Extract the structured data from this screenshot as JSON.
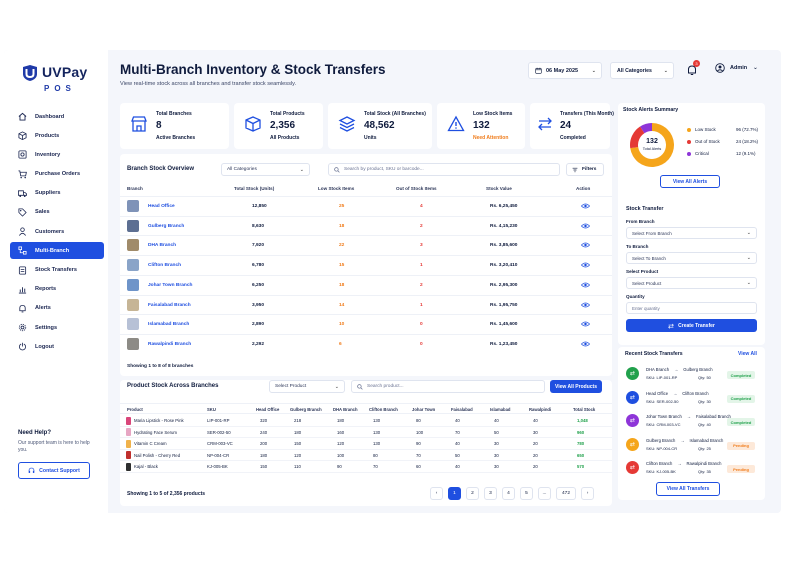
{
  "app": {
    "name": "UVPay",
    "sub": "POS"
  },
  "sidebar": {
    "items": [
      {
        "label": "Dashboard",
        "icon": "home-icon"
      },
      {
        "label": "Products",
        "icon": "box-icon"
      },
      {
        "label": "Inventory",
        "icon": "inventory-icon"
      },
      {
        "label": "Purchase Orders",
        "icon": "cart-icon"
      },
      {
        "label": "Suppliers",
        "icon": "truck-icon"
      },
      {
        "label": "Sales",
        "icon": "tag-icon"
      },
      {
        "label": "Customers",
        "icon": "users-icon"
      },
      {
        "label": "Multi-Branch",
        "icon": "branch-icon"
      },
      {
        "label": "Stock Transfers",
        "icon": "transfer-icon"
      },
      {
        "label": "Reports",
        "icon": "report-icon"
      },
      {
        "label": "Alerts",
        "icon": "alert-icon"
      },
      {
        "label": "Settings",
        "icon": "gear-icon"
      },
      {
        "label": "Logout",
        "icon": "logout-icon"
      }
    ],
    "active_index": 7,
    "help": {
      "title": "Need Help?",
      "text": "Our support team is here to help you.",
      "button": "Contact Support"
    }
  },
  "header": {
    "title": "Multi-Branch Inventory & Stock Transfers",
    "subtitle": "View real-time stock across all branches and transfer stock seamlessly.",
    "date": "06 May 2025",
    "category": "All Categories",
    "notifications": "3",
    "user": "Admin"
  },
  "stats": [
    {
      "label": "Total Branches",
      "value": "8",
      "sub": "Active Branches",
      "icon": "store-icon"
    },
    {
      "label": "Total Products",
      "value": "2,356",
      "sub": "All Products",
      "icon": "cube-icon"
    },
    {
      "label": "Total Stock (All Branches)",
      "value": "48,562",
      "sub": "Units",
      "icon": "layers-icon"
    },
    {
      "label": "Low Stock Items",
      "value": "132",
      "sub": "Need Attention",
      "icon": "warning-icon"
    },
    {
      "label": "Transfers (This Month)",
      "value": "24",
      "sub": "Completed",
      "icon": "swap-icon"
    }
  ],
  "branch_overview": {
    "title": "Branch Stock Overview",
    "category": "All Categories",
    "search_placeholder": "Search by product, SKU or barcode...",
    "filters": "Filters",
    "columns": [
      "Branch",
      "Total Stock (Units)",
      "Low Stock Items",
      "Out of Stock Items",
      "Stock Value",
      "Action"
    ],
    "rows": [
      {
        "name": "Head Office",
        "total": "12,850",
        "low": "25",
        "out": "4",
        "value": "Rs. 6,25,450"
      },
      {
        "name": "Gulberg Branch",
        "total": "8,630",
        "low": "18",
        "out": "2",
        "value": "Rs. 4,15,230"
      },
      {
        "name": "DHA Branch",
        "total": "7,920",
        "low": "22",
        "out": "3",
        "value": "Rs. 3,85,600"
      },
      {
        "name": "Clifton Branch",
        "total": "6,780",
        "low": "15",
        "out": "1",
        "value": "Rs. 3,20,410"
      },
      {
        "name": "Johar Town Branch",
        "total": "6,250",
        "low": "18",
        "out": "2",
        "value": "Rs. 2,95,300"
      },
      {
        "name": "Faisalabad Branch",
        "total": "3,950",
        "low": "14",
        "out": "1",
        "value": "Rs. 1,95,750"
      },
      {
        "name": "Islamabad Branch",
        "total": "2,890",
        "low": "10",
        "out": "0",
        "value": "Rs. 1,45,600"
      },
      {
        "name": "Rawalpindi Branch",
        "total": "2,292",
        "low": "6",
        "out": "0",
        "value": "Rs. 1,23,450"
      }
    ],
    "footer": "Showing 1 to 8 of 8 branches"
  },
  "product_stock": {
    "title": "Product Stock Across Branches",
    "select_product": "Select Product",
    "search_placeholder": "Search product...",
    "view_all": "View All Products",
    "columns": [
      "Product",
      "SKU",
      "Head Office",
      "Gulberg Branch",
      "DHA Branch",
      "Clifton Branch",
      "Johar Town",
      "Faisalabad",
      "Islamabad",
      "Rawalpindi",
      "Total Stock"
    ],
    "rows": [
      {
        "name": "Maria Lipstick - Rose Pink",
        "sku": "LIP-001-RP",
        "vals": [
          "320",
          "218",
          "180",
          "130",
          "80",
          "40",
          "40",
          "40"
        ],
        "total": "1,048"
      },
      {
        "name": "Hydrating Face Serum",
        "sku": "SER-002-50",
        "vals": [
          "240",
          "180",
          "160",
          "130",
          "100",
          "70",
          "50",
          "30"
        ],
        "total": "960"
      },
      {
        "name": "Vitamin C Cream",
        "sku": "CRM-003-VC",
        "vals": [
          "200",
          "150",
          "120",
          "130",
          "90",
          "40",
          "30",
          "20"
        ],
        "total": "780"
      },
      {
        "name": "Nail Polish - Cherry Red",
        "sku": "NP-004-CR",
        "vals": [
          "180",
          "120",
          "100",
          "80",
          "70",
          "50",
          "30",
          "20"
        ],
        "total": "650"
      },
      {
        "name": "Kajal - Black",
        "sku": "KJ-005-BK",
        "vals": [
          "150",
          "110",
          "90",
          "70",
          "60",
          "40",
          "30",
          "20"
        ],
        "total": "570"
      }
    ],
    "footer": "Showing 1 to 5 of 2,356 products",
    "pages": [
      "‹",
      "1",
      "2",
      "3",
      "4",
      "5",
      "...",
      "472",
      "›"
    ]
  },
  "stock_alerts": {
    "title": "Stock Alerts Summary",
    "center_value": "132",
    "center_label": "Total Alerts",
    "items": [
      {
        "label": "Low Stock",
        "value": "96 (72.7%)",
        "color": "#f5a51b",
        "fraction": 0.727
      },
      {
        "label": "Out of Stock",
        "value": "24 (18.2%)",
        "color": "#e53935",
        "fraction": 0.182
      },
      {
        "label": "Critical",
        "value": "12 (9.1%)",
        "color": "#8e35d8",
        "fraction": 0.091
      }
    ],
    "view_all": "View All Alerts"
  },
  "stock_transfer": {
    "title": "Stock Transfer",
    "from_label": "From Branch",
    "from_placeholder": "Select From Branch",
    "to_label": "To Branch",
    "to_placeholder": "Select To Branch",
    "product_label": "Select Product",
    "product_placeholder": "Select Product",
    "qty_label": "Quantity",
    "qty_placeholder": "Enter quantity",
    "submit": "Create Transfer"
  },
  "recent_transfers": {
    "title": "Recent Stock Transfers",
    "view_all": "View All",
    "items": [
      {
        "from": "DHA Branch",
        "to": "Gulberg Branch",
        "sku": "SKU: LIP-001-RP",
        "qty": "Qty: 50",
        "status": "Completed",
        "color": "#21a14c"
      },
      {
        "from": "Head Office",
        "to": "Clifton Branch",
        "sku": "SKU: SER-002-50",
        "qty": "Qty: 30",
        "status": "Completed",
        "color": "#1f4fe0"
      },
      {
        "from": "Johar Town Branch",
        "to": "Faisalabad Branch",
        "sku": "SKU: CRM-003-VC",
        "qty": "Qty: 40",
        "status": "Completed",
        "color": "#8e35d8"
      },
      {
        "from": "Gulberg Branch",
        "to": "Islamabad Branch",
        "sku": "SKU: NP-004-CR",
        "qty": "Qty: 25",
        "status": "Pending",
        "color": "#f5a51b"
      },
      {
        "from": "Clifton Branch",
        "to": "Rawalpindi Branch",
        "sku": "SKU: KJ-005-BK",
        "qty": "Qty: 35",
        "status": "Pending",
        "color": "#e53935"
      }
    ],
    "view_all_btn": "View All Transfers"
  }
}
